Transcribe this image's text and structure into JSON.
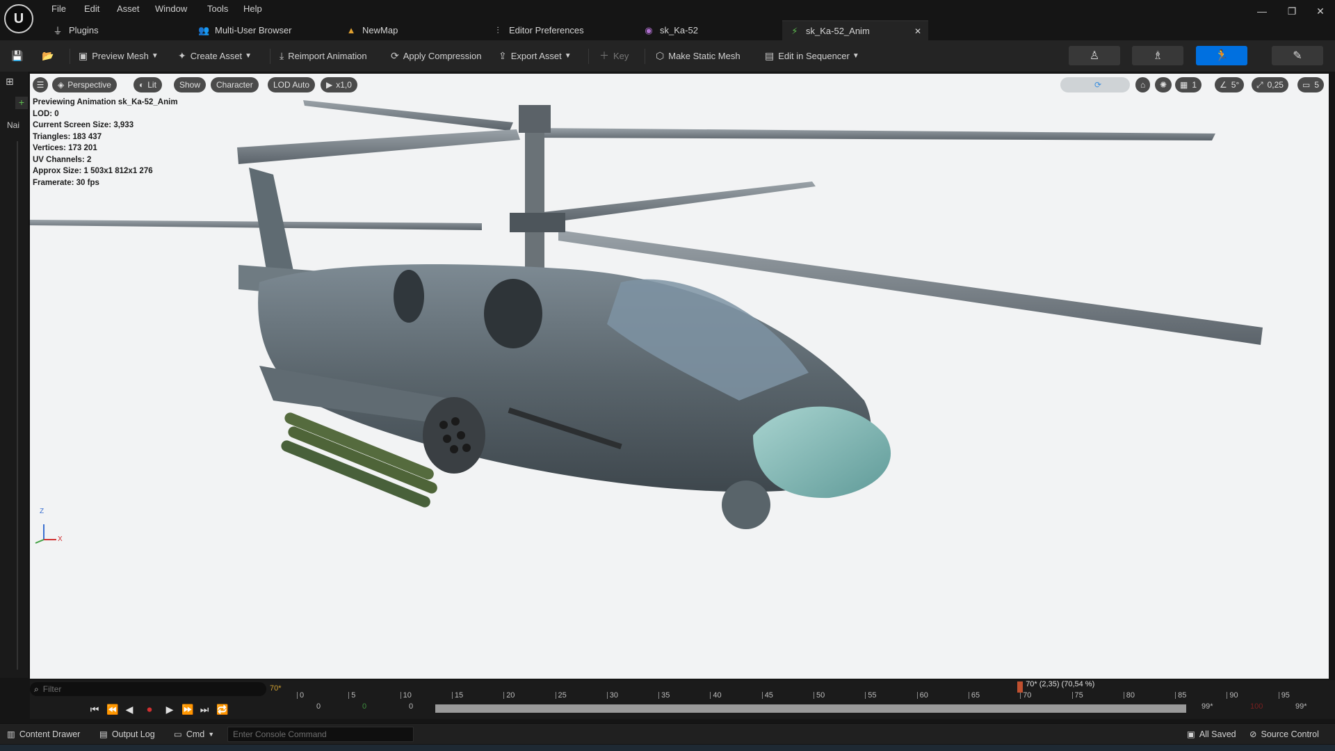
{
  "menu": [
    "File",
    "Edit",
    "Asset",
    "Window",
    "Tools",
    "Help"
  ],
  "logo": "U",
  "window_controls": {
    "minimize": "—",
    "restore": "❐",
    "close": "✕"
  },
  "tabs": [
    {
      "label": "Plugins",
      "icon": "plug-icon"
    },
    {
      "label": "Multi-User Browser",
      "icon": "users-icon"
    },
    {
      "label": "NewMap",
      "icon": "map-icon"
    },
    {
      "label": "Editor Preferences",
      "icon": "sliders-icon"
    },
    {
      "label": "sk_Ka-52",
      "icon": "skeleton-icon"
    },
    {
      "label": "sk_Ka-52_Anim",
      "icon": "animation-icon",
      "active": true
    }
  ],
  "tab_close": "✕",
  "toolbar": {
    "preview_mesh": "Preview Mesh",
    "create_asset": "Create Asset",
    "reimport_animation": "Reimport Animation",
    "apply_compression": "Apply Compression",
    "export_asset": "Export Asset",
    "key": "Key",
    "make_static_mesh": "Make Static Mesh",
    "edit_in_sequencer": "Edit in Sequencer"
  },
  "left_strip": {
    "name_label": "Nai"
  },
  "viewport": {
    "buttons": [
      "Perspective",
      "Lit",
      "Show",
      "Character",
      "LOD Auto",
      "x1,0"
    ],
    "stats": [
      "Previewing Animation sk_Ka-52_Anim",
      "LOD: 0",
      "Current Screen Size: 3,933",
      "Triangles: 183 437",
      "Vertices: 173 201",
      "UV Channels: 2",
      "Approx Size: 1 503x1 812x1 276",
      "Framerate: 30 fps"
    ],
    "right_controls": {
      "grid": "1",
      "angle": "5°",
      "scale": "0,25",
      "camera": "5"
    },
    "axis": {
      "z": "Z",
      "x": "X"
    }
  },
  "timeline": {
    "filter_placeholder": "Filter",
    "current_frame_label": "70*",
    "ticks": [
      "0",
      "5",
      "10",
      "15",
      "20",
      "25",
      "30",
      "35",
      "40",
      "45",
      "50",
      "55",
      "60",
      "65",
      "70",
      "75",
      "80",
      "85",
      "90",
      "95"
    ],
    "playhead_label": "70* (2,35) (70,54 %)",
    "playhead_frame": 70,
    "range_start_values": [
      "0",
      "0",
      "0"
    ],
    "range_end_values": [
      "99*",
      "100",
      "99*"
    ]
  },
  "bottom_bar": {
    "content_drawer": "Content Drawer",
    "output_log": "Output Log",
    "cmd": "Cmd",
    "console_placeholder": "Enter Console Command",
    "all_saved": "All Saved",
    "source_control": "Source Control"
  },
  "colors": {
    "accent": "#0070e0",
    "viewport_bg": "#f2f3f4",
    "record": "#d03030",
    "playhead": "#c0502f"
  }
}
